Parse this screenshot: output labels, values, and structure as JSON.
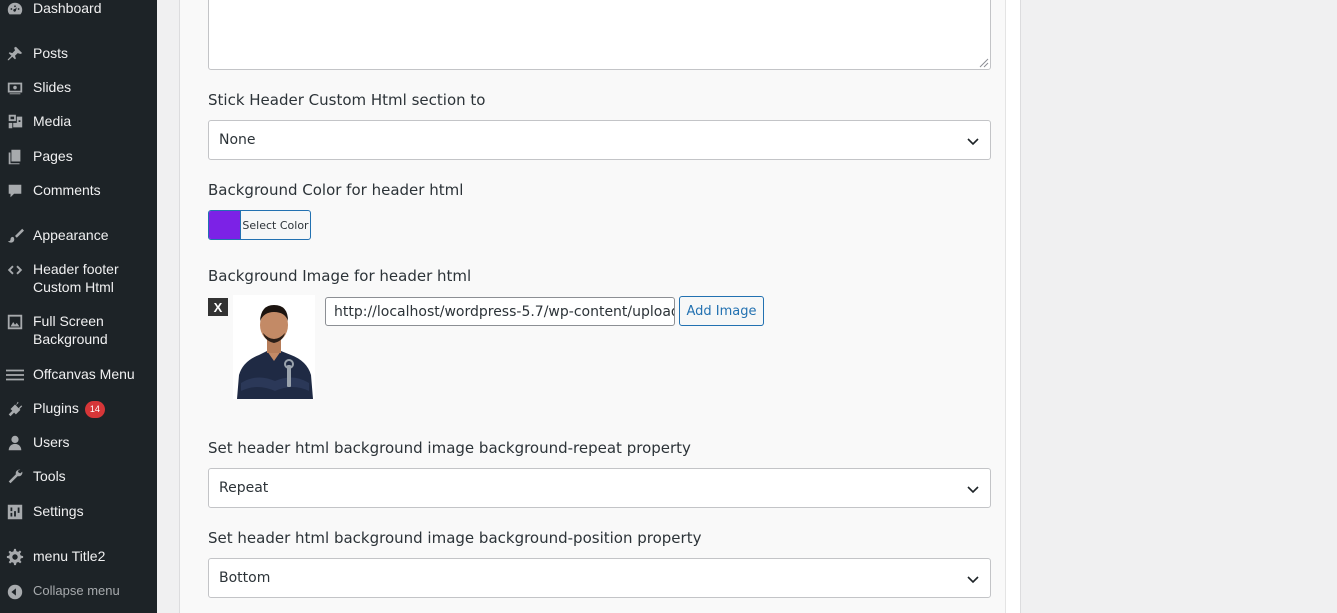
{
  "sidebar": {
    "items": [
      {
        "label": "Dashboard",
        "icon": "dashboard-icon"
      },
      {
        "label": "Posts",
        "icon": "pin-icon"
      },
      {
        "label": "Slides",
        "icon": "slides-icon"
      },
      {
        "label": "Media",
        "icon": "media-icon"
      },
      {
        "label": "Pages",
        "icon": "pages-icon"
      },
      {
        "label": "Comments",
        "icon": "comment-icon"
      },
      {
        "label": "Appearance",
        "icon": "brush-icon"
      },
      {
        "label": "Header footer Custom Html",
        "icon": "code-icon"
      },
      {
        "label": "Full Screen Background",
        "icon": "image-icon"
      },
      {
        "label": "Offcanvas Menu",
        "icon": "menu-icon"
      },
      {
        "label": "Plugins",
        "icon": "plug-icon",
        "badge": "14"
      },
      {
        "label": "Users",
        "icon": "user-icon"
      },
      {
        "label": "Tools",
        "icon": "wrench-icon"
      },
      {
        "label": "Settings",
        "icon": "settings-icon"
      },
      {
        "label": "menu Title2",
        "icon": "gear-icon"
      },
      {
        "label": "Collapse menu",
        "icon": "collapse-icon"
      }
    ]
  },
  "form": {
    "stick_label": "Stick Header Custom Html section to",
    "stick_value": "None",
    "bgcolor_label": "Background Color for header html",
    "select_color_label": "Select Color",
    "swatch_color": "#7c22e6",
    "bgimage_label": "Background Image for header html",
    "remove_label": "X",
    "image_url": "http://localhost/wordpress-5.7/wp-content/uploads/2",
    "add_image_label": "Add Image",
    "repeat_label": "Set header html background image background-repeat property",
    "repeat_value": "Repeat",
    "position_label": "Set header html background image background-position property",
    "position_value": "Bottom"
  },
  "colors": {
    "sidebar_bg": "#1d2327",
    "accent": "#2271b1",
    "badge": "#d63638"
  }
}
